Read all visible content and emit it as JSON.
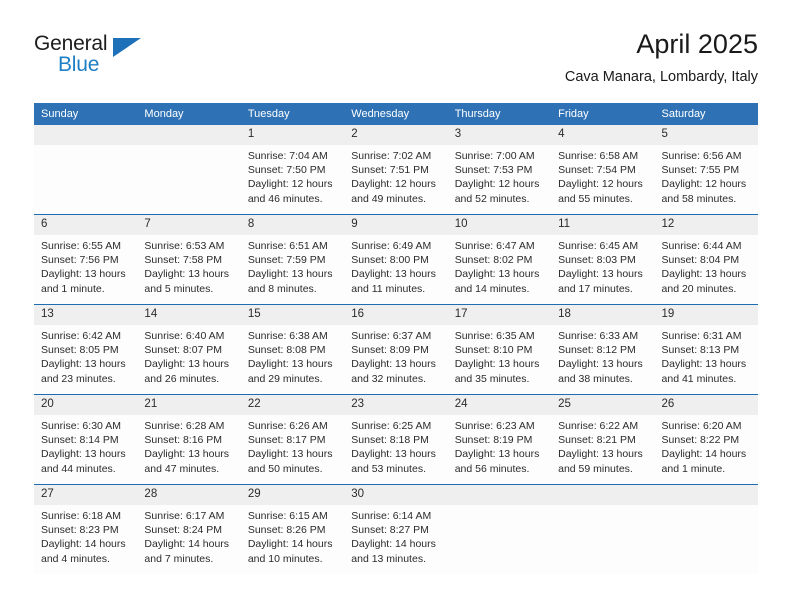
{
  "brand": {
    "word_one": "General",
    "word_two": "Blue",
    "triangle_icon": "triangle-icon",
    "accent_color": "#1f7fc4"
  },
  "header": {
    "title": "April 2025",
    "subtitle": "Cava Manara, Lombardy, Italy"
  },
  "theme": {
    "header_blue": "#2e72b5",
    "row_rule_blue": "#1f6cb0",
    "daynum_bg": "#efefef"
  },
  "weekday_headers": [
    "Sunday",
    "Monday",
    "Tuesday",
    "Wednesday",
    "Thursday",
    "Friday",
    "Saturday"
  ],
  "weeks": [
    [
      {
        "day": "",
        "sunrise": "",
        "sunset": "",
        "daylight": "",
        "daylight2": ""
      },
      {
        "day": "",
        "sunrise": "",
        "sunset": "",
        "daylight": "",
        "daylight2": ""
      },
      {
        "day": "1",
        "sunrise": "Sunrise: 7:04 AM",
        "sunset": "Sunset: 7:50 PM",
        "daylight": "Daylight: 12 hours",
        "daylight2": "and 46 minutes."
      },
      {
        "day": "2",
        "sunrise": "Sunrise: 7:02 AM",
        "sunset": "Sunset: 7:51 PM",
        "daylight": "Daylight: 12 hours",
        "daylight2": "and 49 minutes."
      },
      {
        "day": "3",
        "sunrise": "Sunrise: 7:00 AM",
        "sunset": "Sunset: 7:53 PM",
        "daylight": "Daylight: 12 hours",
        "daylight2": "and 52 minutes."
      },
      {
        "day": "4",
        "sunrise": "Sunrise: 6:58 AM",
        "sunset": "Sunset: 7:54 PM",
        "daylight": "Daylight: 12 hours",
        "daylight2": "and 55 minutes."
      },
      {
        "day": "5",
        "sunrise": "Sunrise: 6:56 AM",
        "sunset": "Sunset: 7:55 PM",
        "daylight": "Daylight: 12 hours",
        "daylight2": "and 58 minutes."
      }
    ],
    [
      {
        "day": "6",
        "sunrise": "Sunrise: 6:55 AM",
        "sunset": "Sunset: 7:56 PM",
        "daylight": "Daylight: 13 hours",
        "daylight2": "and 1 minute."
      },
      {
        "day": "7",
        "sunrise": "Sunrise: 6:53 AM",
        "sunset": "Sunset: 7:58 PM",
        "daylight": "Daylight: 13 hours",
        "daylight2": "and 5 minutes."
      },
      {
        "day": "8",
        "sunrise": "Sunrise: 6:51 AM",
        "sunset": "Sunset: 7:59 PM",
        "daylight": "Daylight: 13 hours",
        "daylight2": "and 8 minutes."
      },
      {
        "day": "9",
        "sunrise": "Sunrise: 6:49 AM",
        "sunset": "Sunset: 8:00 PM",
        "daylight": "Daylight: 13 hours",
        "daylight2": "and 11 minutes."
      },
      {
        "day": "10",
        "sunrise": "Sunrise: 6:47 AM",
        "sunset": "Sunset: 8:02 PM",
        "daylight": "Daylight: 13 hours",
        "daylight2": "and 14 minutes."
      },
      {
        "day": "11",
        "sunrise": "Sunrise: 6:45 AM",
        "sunset": "Sunset: 8:03 PM",
        "daylight": "Daylight: 13 hours",
        "daylight2": "and 17 minutes."
      },
      {
        "day": "12",
        "sunrise": "Sunrise: 6:44 AM",
        "sunset": "Sunset: 8:04 PM",
        "daylight": "Daylight: 13 hours",
        "daylight2": "and 20 minutes."
      }
    ],
    [
      {
        "day": "13",
        "sunrise": "Sunrise: 6:42 AM",
        "sunset": "Sunset: 8:05 PM",
        "daylight": "Daylight: 13 hours",
        "daylight2": "and 23 minutes."
      },
      {
        "day": "14",
        "sunrise": "Sunrise: 6:40 AM",
        "sunset": "Sunset: 8:07 PM",
        "daylight": "Daylight: 13 hours",
        "daylight2": "and 26 minutes."
      },
      {
        "day": "15",
        "sunrise": "Sunrise: 6:38 AM",
        "sunset": "Sunset: 8:08 PM",
        "daylight": "Daylight: 13 hours",
        "daylight2": "and 29 minutes."
      },
      {
        "day": "16",
        "sunrise": "Sunrise: 6:37 AM",
        "sunset": "Sunset: 8:09 PM",
        "daylight": "Daylight: 13 hours",
        "daylight2": "and 32 minutes."
      },
      {
        "day": "17",
        "sunrise": "Sunrise: 6:35 AM",
        "sunset": "Sunset: 8:10 PM",
        "daylight": "Daylight: 13 hours",
        "daylight2": "and 35 minutes."
      },
      {
        "day": "18",
        "sunrise": "Sunrise: 6:33 AM",
        "sunset": "Sunset: 8:12 PM",
        "daylight": "Daylight: 13 hours",
        "daylight2": "and 38 minutes."
      },
      {
        "day": "19",
        "sunrise": "Sunrise: 6:31 AM",
        "sunset": "Sunset: 8:13 PM",
        "daylight": "Daylight: 13 hours",
        "daylight2": "and 41 minutes."
      }
    ],
    [
      {
        "day": "20",
        "sunrise": "Sunrise: 6:30 AM",
        "sunset": "Sunset: 8:14 PM",
        "daylight": "Daylight: 13 hours",
        "daylight2": "and 44 minutes."
      },
      {
        "day": "21",
        "sunrise": "Sunrise: 6:28 AM",
        "sunset": "Sunset: 8:16 PM",
        "daylight": "Daylight: 13 hours",
        "daylight2": "and 47 minutes."
      },
      {
        "day": "22",
        "sunrise": "Sunrise: 6:26 AM",
        "sunset": "Sunset: 8:17 PM",
        "daylight": "Daylight: 13 hours",
        "daylight2": "and 50 minutes."
      },
      {
        "day": "23",
        "sunrise": "Sunrise: 6:25 AM",
        "sunset": "Sunset: 8:18 PM",
        "daylight": "Daylight: 13 hours",
        "daylight2": "and 53 minutes."
      },
      {
        "day": "24",
        "sunrise": "Sunrise: 6:23 AM",
        "sunset": "Sunset: 8:19 PM",
        "daylight": "Daylight: 13 hours",
        "daylight2": "and 56 minutes."
      },
      {
        "day": "25",
        "sunrise": "Sunrise: 6:22 AM",
        "sunset": "Sunset: 8:21 PM",
        "daylight": "Daylight: 13 hours",
        "daylight2": "and 59 minutes."
      },
      {
        "day": "26",
        "sunrise": "Sunrise: 6:20 AM",
        "sunset": "Sunset: 8:22 PM",
        "daylight": "Daylight: 14 hours",
        "daylight2": "and 1 minute."
      }
    ],
    [
      {
        "day": "27",
        "sunrise": "Sunrise: 6:18 AM",
        "sunset": "Sunset: 8:23 PM",
        "daylight": "Daylight: 14 hours",
        "daylight2": "and 4 minutes."
      },
      {
        "day": "28",
        "sunrise": "Sunrise: 6:17 AM",
        "sunset": "Sunset: 8:24 PM",
        "daylight": "Daylight: 14 hours",
        "daylight2": "and 7 minutes."
      },
      {
        "day": "29",
        "sunrise": "Sunrise: 6:15 AM",
        "sunset": "Sunset: 8:26 PM",
        "daylight": "Daylight: 14 hours",
        "daylight2": "and 10 minutes."
      },
      {
        "day": "30",
        "sunrise": "Sunrise: 6:14 AM",
        "sunset": "Sunset: 8:27 PM",
        "daylight": "Daylight: 14 hours",
        "daylight2": "and 13 minutes."
      },
      {
        "day": "",
        "sunrise": "",
        "sunset": "",
        "daylight": "",
        "daylight2": ""
      },
      {
        "day": "",
        "sunrise": "",
        "sunset": "",
        "daylight": "",
        "daylight2": ""
      },
      {
        "day": "",
        "sunrise": "",
        "sunset": "",
        "daylight": "",
        "daylight2": ""
      }
    ]
  ]
}
